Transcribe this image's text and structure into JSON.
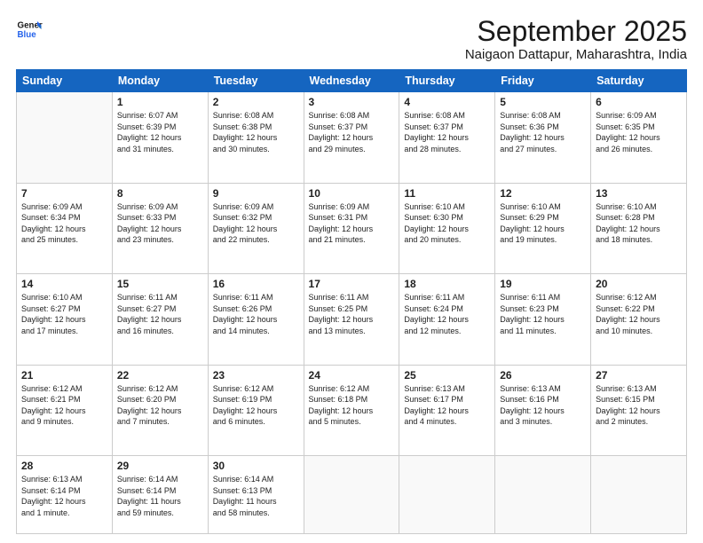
{
  "logo": {
    "line1": "General",
    "line2": "Blue"
  },
  "title": "September 2025",
  "location": "Naigaon Dattapur, Maharashtra, India",
  "weekdays": [
    "Sunday",
    "Monday",
    "Tuesday",
    "Wednesday",
    "Thursday",
    "Friday",
    "Saturday"
  ],
  "weeks": [
    [
      {
        "day": "",
        "info": ""
      },
      {
        "day": "1",
        "info": "Sunrise: 6:07 AM\nSunset: 6:39 PM\nDaylight: 12 hours\nand 31 minutes."
      },
      {
        "day": "2",
        "info": "Sunrise: 6:08 AM\nSunset: 6:38 PM\nDaylight: 12 hours\nand 30 minutes."
      },
      {
        "day": "3",
        "info": "Sunrise: 6:08 AM\nSunset: 6:37 PM\nDaylight: 12 hours\nand 29 minutes."
      },
      {
        "day": "4",
        "info": "Sunrise: 6:08 AM\nSunset: 6:37 PM\nDaylight: 12 hours\nand 28 minutes."
      },
      {
        "day": "5",
        "info": "Sunrise: 6:08 AM\nSunset: 6:36 PM\nDaylight: 12 hours\nand 27 minutes."
      },
      {
        "day": "6",
        "info": "Sunrise: 6:09 AM\nSunset: 6:35 PM\nDaylight: 12 hours\nand 26 minutes."
      }
    ],
    [
      {
        "day": "7",
        "info": "Sunrise: 6:09 AM\nSunset: 6:34 PM\nDaylight: 12 hours\nand 25 minutes."
      },
      {
        "day": "8",
        "info": "Sunrise: 6:09 AM\nSunset: 6:33 PM\nDaylight: 12 hours\nand 23 minutes."
      },
      {
        "day": "9",
        "info": "Sunrise: 6:09 AM\nSunset: 6:32 PM\nDaylight: 12 hours\nand 22 minutes."
      },
      {
        "day": "10",
        "info": "Sunrise: 6:09 AM\nSunset: 6:31 PM\nDaylight: 12 hours\nand 21 minutes."
      },
      {
        "day": "11",
        "info": "Sunrise: 6:10 AM\nSunset: 6:30 PM\nDaylight: 12 hours\nand 20 minutes."
      },
      {
        "day": "12",
        "info": "Sunrise: 6:10 AM\nSunset: 6:29 PM\nDaylight: 12 hours\nand 19 minutes."
      },
      {
        "day": "13",
        "info": "Sunrise: 6:10 AM\nSunset: 6:28 PM\nDaylight: 12 hours\nand 18 minutes."
      }
    ],
    [
      {
        "day": "14",
        "info": "Sunrise: 6:10 AM\nSunset: 6:27 PM\nDaylight: 12 hours\nand 17 minutes."
      },
      {
        "day": "15",
        "info": "Sunrise: 6:11 AM\nSunset: 6:27 PM\nDaylight: 12 hours\nand 16 minutes."
      },
      {
        "day": "16",
        "info": "Sunrise: 6:11 AM\nSunset: 6:26 PM\nDaylight: 12 hours\nand 14 minutes."
      },
      {
        "day": "17",
        "info": "Sunrise: 6:11 AM\nSunset: 6:25 PM\nDaylight: 12 hours\nand 13 minutes."
      },
      {
        "day": "18",
        "info": "Sunrise: 6:11 AM\nSunset: 6:24 PM\nDaylight: 12 hours\nand 12 minutes."
      },
      {
        "day": "19",
        "info": "Sunrise: 6:11 AM\nSunset: 6:23 PM\nDaylight: 12 hours\nand 11 minutes."
      },
      {
        "day": "20",
        "info": "Sunrise: 6:12 AM\nSunset: 6:22 PM\nDaylight: 12 hours\nand 10 minutes."
      }
    ],
    [
      {
        "day": "21",
        "info": "Sunrise: 6:12 AM\nSunset: 6:21 PM\nDaylight: 12 hours\nand 9 minutes."
      },
      {
        "day": "22",
        "info": "Sunrise: 6:12 AM\nSunset: 6:20 PM\nDaylight: 12 hours\nand 7 minutes."
      },
      {
        "day": "23",
        "info": "Sunrise: 6:12 AM\nSunset: 6:19 PM\nDaylight: 12 hours\nand 6 minutes."
      },
      {
        "day": "24",
        "info": "Sunrise: 6:12 AM\nSunset: 6:18 PM\nDaylight: 12 hours\nand 5 minutes."
      },
      {
        "day": "25",
        "info": "Sunrise: 6:13 AM\nSunset: 6:17 PM\nDaylight: 12 hours\nand 4 minutes."
      },
      {
        "day": "26",
        "info": "Sunrise: 6:13 AM\nSunset: 6:16 PM\nDaylight: 12 hours\nand 3 minutes."
      },
      {
        "day": "27",
        "info": "Sunrise: 6:13 AM\nSunset: 6:15 PM\nDaylight: 12 hours\nand 2 minutes."
      }
    ],
    [
      {
        "day": "28",
        "info": "Sunrise: 6:13 AM\nSunset: 6:14 PM\nDaylight: 12 hours\nand 1 minute."
      },
      {
        "day": "29",
        "info": "Sunrise: 6:14 AM\nSunset: 6:14 PM\nDaylight: 11 hours\nand 59 minutes."
      },
      {
        "day": "30",
        "info": "Sunrise: 6:14 AM\nSunset: 6:13 PM\nDaylight: 11 hours\nand 58 minutes."
      },
      {
        "day": "",
        "info": ""
      },
      {
        "day": "",
        "info": ""
      },
      {
        "day": "",
        "info": ""
      },
      {
        "day": "",
        "info": ""
      }
    ]
  ]
}
